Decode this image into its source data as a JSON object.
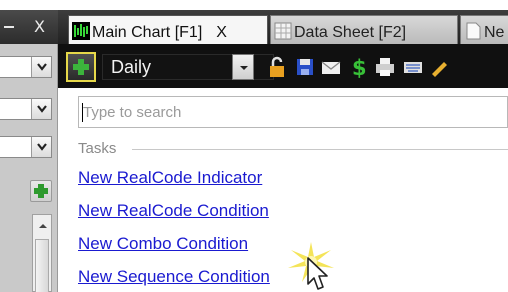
{
  "left_panel": {
    "close_label": "X"
  },
  "tabs": [
    {
      "label": "Main Chart",
      "shortcut": "[F1]",
      "close": "X"
    },
    {
      "label": "Data Sheet",
      "shortcut": "[F2]"
    },
    {
      "label": "Ne"
    }
  ],
  "toolbar": {
    "interval": "Daily",
    "icons": [
      "add-icon",
      "lock-icon",
      "save-icon",
      "mail-icon",
      "dollar-icon",
      "print-icon",
      "keyboard-icon",
      "pencil-icon"
    ]
  },
  "search": {
    "placeholder": "Type to search",
    "value": ""
  },
  "tasks": {
    "header": "Tasks",
    "items": [
      "New RealCode Indicator",
      "New RealCode Condition",
      "New Combo Condition",
      "New Sequence Condition"
    ]
  },
  "colors": {
    "accent_green": "#2e9a2e",
    "link_blue": "#1a1ad0",
    "toolbar_bg": "#101010"
  }
}
